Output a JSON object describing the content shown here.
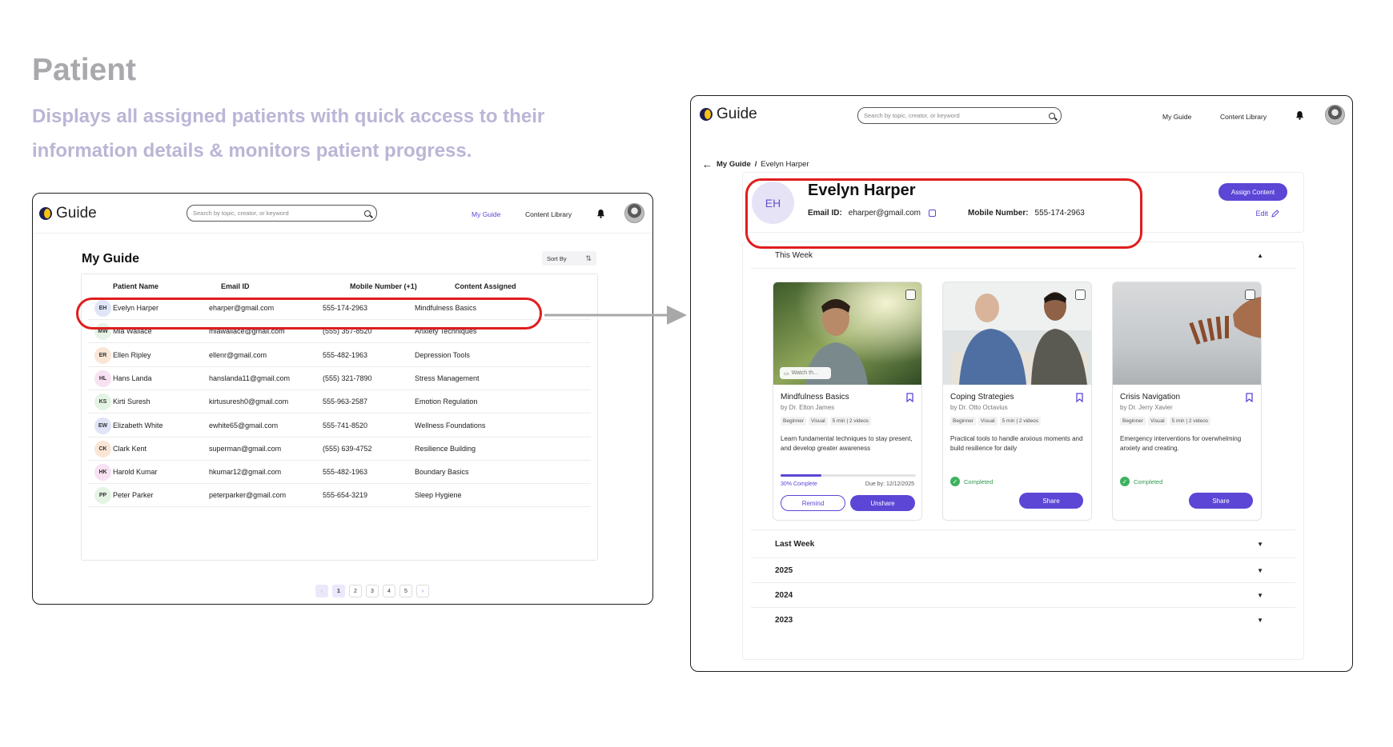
{
  "hero": {
    "title": "Patient",
    "description": "Displays all assigned patients with quick access to their information details & monitors patient progress."
  },
  "colors": {
    "accent": "#5b46d6",
    "highlight": "#e01d1d",
    "success": "#3cb25d"
  },
  "nav": {
    "logo": "Guide",
    "search_placeholder": "Search by topic, creator, or keyword",
    "links": [
      "My Guide",
      "Content Library"
    ],
    "bell_icon": "bell-icon"
  },
  "list_page": {
    "title": "My Guide",
    "sort_label": "Sort By",
    "columns": [
      "Patient Name",
      "Email ID",
      "Mobile Number (+1)",
      "Content Assigned"
    ],
    "rows": [
      {
        "initials": "EH",
        "name": "Evelyn Harper",
        "email": "eharper@gmail.com",
        "phone": "555-174-2963",
        "content": "Mindfulness Basics",
        "color": "#dfe4f7"
      },
      {
        "initials": "MW",
        "name": "Mia Wallace",
        "email": "miawallace@gmail.com",
        "phone": "(555) 357-8520",
        "content": "Anxiety Techniques",
        "color": "#e6f3e6"
      },
      {
        "initials": "ER",
        "name": "Ellen Ripley",
        "email": "ellenr@gmail.com",
        "phone": "555-482-1963",
        "content": "Depression Tools",
        "color": "#fbe6d6"
      },
      {
        "initials": "HL",
        "name": "Hans Landa",
        "email": "hanslanda11@gmail.com",
        "phone": "(555) 321-7890",
        "content": "Stress Management",
        "color": "#f7e1f2"
      },
      {
        "initials": "KS",
        "name": "Kirti Suresh",
        "email": "kirtusuresh0@gmail.com",
        "phone": "555-963-2587",
        "content": "Emotion Regulation",
        "color": "#e4f4e4"
      },
      {
        "initials": "EW",
        "name": "Elizabeth White",
        "email": "ewhite65@gmail.com",
        "phone": "555-741-8520",
        "content": "Wellness Foundations",
        "color": "#dfe4f7"
      },
      {
        "initials": "CK",
        "name": "Clark Kent",
        "email": "superman@gmail.com",
        "phone": "(555) 639-4752",
        "content": "Resilience Building",
        "color": "#fbe6d6"
      },
      {
        "initials": "HK",
        "name": "Harold Kumar",
        "email": "hkumar12@gmail.com",
        "phone": "555-482-1963",
        "content": "Boundary Basics",
        "color": "#f7e1f2"
      },
      {
        "initials": "PP",
        "name": "Peter Parker",
        "email": "peterparker@gmail.com",
        "phone": "555-654-3219",
        "content": "Sleep Hygiene",
        "color": "#e4f4e4"
      }
    ],
    "pagination": {
      "prev": "‹",
      "pages": [
        "1",
        "2",
        "3",
        "4",
        "5"
      ],
      "next": "›",
      "current": "1"
    }
  },
  "detail_page": {
    "breadcrumb_parent": "My Guide",
    "breadcrumb_sep": "/",
    "breadcrumb_current": "Evelyn Harper",
    "patient": {
      "initials": "EH",
      "name": "Evelyn Harper",
      "email_label": "Email ID:",
      "email": "eharper@gmail.com",
      "mobile_label": "Mobile Number:",
      "mobile": "555-174-2963"
    },
    "assign_button": "Assign Content",
    "edit_link": "Edit",
    "sections": [
      {
        "label": "This Week",
        "expanded": true
      },
      {
        "label": "Last Week",
        "expanded": false
      },
      {
        "label": "2025",
        "expanded": false
      },
      {
        "label": "2024",
        "expanded": false
      },
      {
        "label": "2023",
        "expanded": false
      }
    ],
    "cards": [
      {
        "title": "Mindfulness Basics",
        "author": "by Dr. Elton James",
        "tags": [
          "Beginner",
          "Visual",
          "5 min | 2 videos"
        ],
        "description": "Learn fundamental techniques to stay present, and develop greater awareness",
        "watch_chip": "Watch th...",
        "progress": 0.3,
        "progress_label": "30% Complete",
        "due": "Due by: 12/12/2025",
        "remind": "Remind",
        "unshare": "Unshare"
      },
      {
        "title": "Coping Strategies",
        "author": "by Dr. Otto Octavius",
        "tags": [
          "Beginner",
          "Visual",
          "5 min | 2 videos"
        ],
        "description": "Practical tools to handle anxious moments and build resilience for daily",
        "status": "Completed",
        "share": "Share"
      },
      {
        "title": "Crisis Navigation",
        "author": "by Dr. Jerry Xavier",
        "tags": [
          "Beginner",
          "Visual",
          "5 min | 2 videos"
        ],
        "description": "Emergency interventions for overwhelming anxiety and creating.",
        "status": "Completed",
        "share": "Share"
      }
    ]
  }
}
